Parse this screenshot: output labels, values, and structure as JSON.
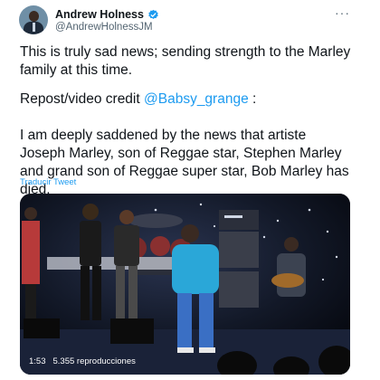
{
  "author": {
    "name": "Andrew Holness",
    "handle": "@AndrewHolnessJM"
  },
  "menu_glyph": "···",
  "tweet": {
    "paragraph1": "This is truly sad news; sending strength to the Marley family at this time.",
    "paragraph2_prefix": "Repost/video credit ",
    "paragraph2_mention": "@Babsy_grange",
    "paragraph2_suffix": " :",
    "paragraph3": "I am deeply saddened by the news that artiste Joseph Marley, son of Reggae star, Stephen Marley and grand son of Reggae super star, Bob Marley has died.",
    "translate_label": "Traducir Tweet"
  },
  "video": {
    "duration": "1:53",
    "views": "5.355 reproducciones"
  },
  "colors": {
    "link": "#1d9bf0",
    "verified": "#1d9bf0",
    "performer_top": "#2aa7d8"
  }
}
